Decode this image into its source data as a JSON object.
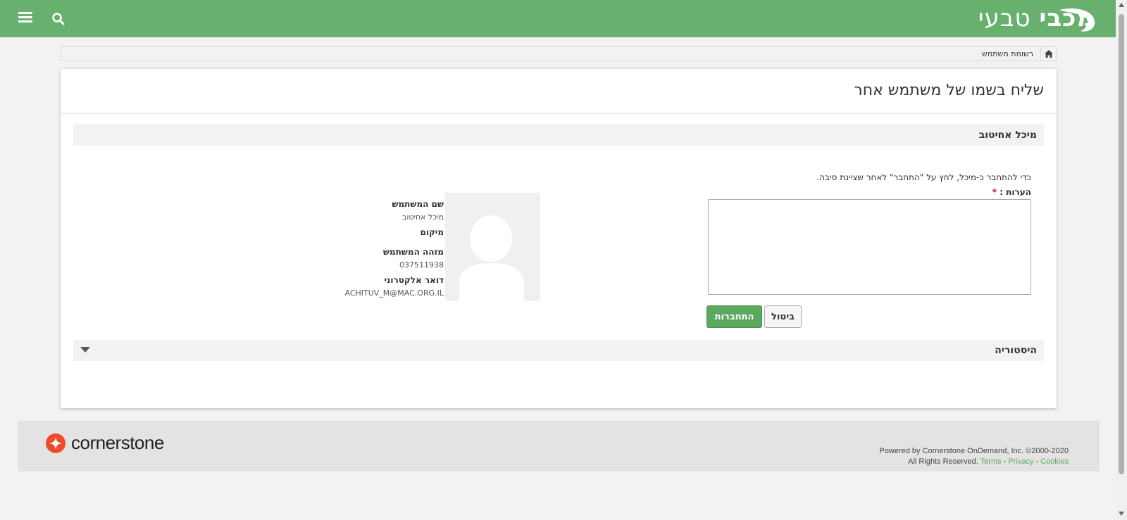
{
  "header": {
    "brand_bold": "מכבי",
    "brand_light": "טבעי",
    "menu_icon": "hamburger-menu-icon",
    "search_icon": "search-icon",
    "bar_color": "#68b06e"
  },
  "breadcrumb": {
    "home_icon": "home-icon",
    "current": "רשומת משתמש"
  },
  "page": {
    "title": "שליח בשמו של משתמש אחר"
  },
  "user_section": {
    "name": "מיכל אחיטוב"
  },
  "form": {
    "instructions": "כדי להתחבר כ-מיכל, לחץ על \"התחבר\" לאחר שציינת סיבה.",
    "comments_label": "הערות :",
    "required_mark": "*",
    "comments_value": "",
    "cancel_label": "ביטול",
    "login_label": "התחברות",
    "login_color": "#5aa95f"
  },
  "user_info": {
    "username_label": "שם המשתמש",
    "username_value": "מיכל אחיטוב",
    "location_label": "מיקום",
    "user_id_label": "מזהה המשתמש",
    "user_id_value": "037511938",
    "email_label": "דואר אלקטרוני",
    "email_value": "ACHITUV_M@MAC.ORG.IL"
  },
  "history_section": {
    "title": "היסטוריה",
    "toggle_icon": "caret-down-icon"
  },
  "footer": {
    "logo_text": "cornerstone",
    "logo_color": "#ee4b2b",
    "powered_by": "Powered by Cornerstone OnDemand, Inc. ©2000-2020",
    "rights": "All Rights Reserved.",
    "terms": "Terms",
    "privacy": "Privacy",
    "cookies": "Cookies",
    "separator": " - "
  }
}
